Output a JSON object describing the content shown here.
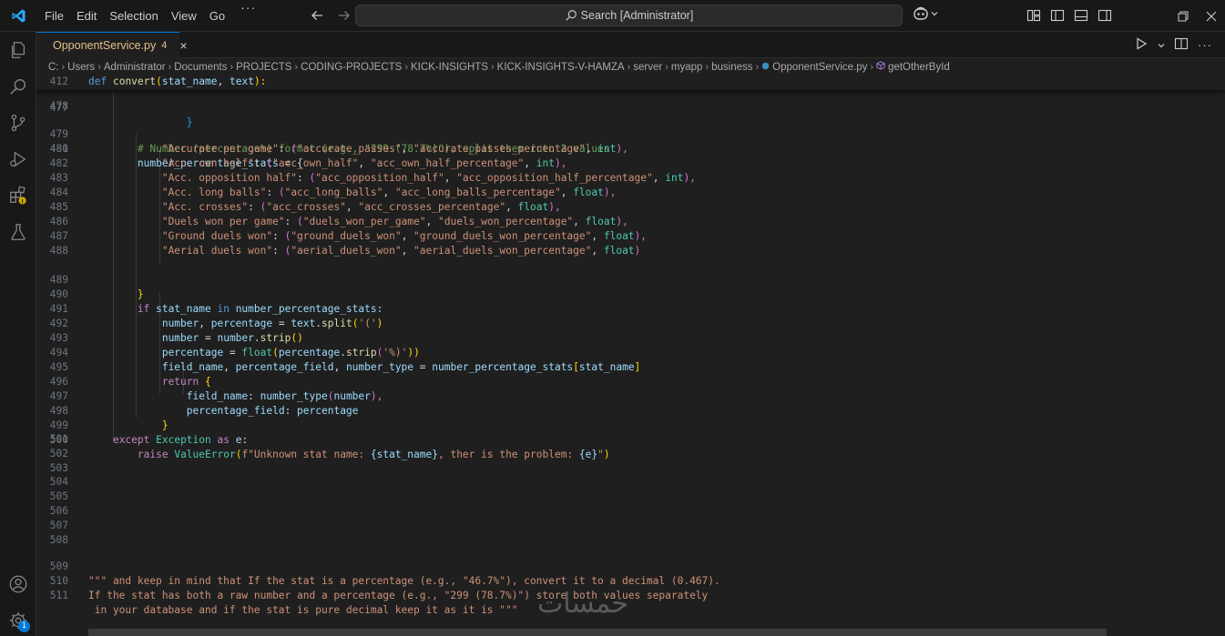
{
  "menu": [
    "File",
    "Edit",
    "Selection",
    "View",
    "Go",
    "···"
  ],
  "search": {
    "label": "Search [Administrator]"
  },
  "tab": {
    "filename": "OpponentService.py",
    "problems": "4",
    "close": "×"
  },
  "breadcrumb": [
    "C:",
    "Users",
    "Administrator",
    "Documents",
    "PROJECTS",
    "CODING-PROJECTS",
    "KICK-INSIGHTS",
    "KICK-INSIGHTS-V-HAMZA",
    "server",
    "myapp",
    "business",
    "OpponentService.py",
    "getOtherById"
  ],
  "activity": {
    "extensions_badge": "⚠",
    "accounts_badge": "",
    "settings_badge": "1"
  },
  "sticky": {
    "line_number": "412",
    "lines_hidden": "477"
  },
  "code": {
    "l412": [
      "def",
      " ",
      "convert",
      "(",
      "stat_name",
      ", ",
      "text",
      "):"
    ],
    "l477": "}",
    "l479": "# Number (percentage%) format (e.g., \"299 (78.7%)\"), split them into 2 values",
    "l480_var": "number_percentage_stats",
    "l480_rest": " = {",
    "stats": [
      {
        "ln": "481",
        "key": "\"Accurate per game\"",
        "a": "\"accurate_passes\"",
        "b": "\"accurate_passes_percentage\"",
        "t": "int",
        "end": "),"
      },
      {
        "ln": "482",
        "key": "\"Acc. own half\"",
        "a": "\"acc_own_half\"",
        "b": "\"acc_own_half_percentage\"",
        "t": "int",
        "end": "),"
      },
      {
        "ln": "483",
        "key": "\"Acc. opposition half\"",
        "a": "\"acc_opposition_half\"",
        "b": "\"acc_opposition_half_percentage\"",
        "t": "int",
        "end": "),"
      },
      {
        "ln": "484",
        "key": "\"Acc. long balls\"",
        "a": "\"acc_long_balls\"",
        "b": "\"acc_long_balls_percentage\"",
        "t": "float",
        "end": "),"
      },
      {
        "ln": "485",
        "key": "\"Acc. crosses\"",
        "a": "\"acc_crosses\"",
        "b": "\"acc_crosses_percentage\"",
        "t": "float",
        "end": "),"
      },
      {
        "ln": "486",
        "key": "\"Duels won per game\"",
        "a": "\"duels_won_per_game\"",
        "b": "\"duels_won_percentage\"",
        "t": "float",
        "end": "),"
      },
      {
        "ln": "487",
        "key": "\"Ground duels won\"",
        "a": "\"ground_duels_won\"",
        "b": "\"ground_duels_won_percentage\"",
        "t": "float",
        "end": "),"
      },
      {
        "ln": "488",
        "key": "\"Aerial duels won\"",
        "a": "\"aerial_duels_won\"",
        "b": "\"aerial_duels_won_percentage\"",
        "t": "float",
        "end": ")"
      }
    ],
    "l489": "}",
    "l490": [
      "if",
      " stat_name ",
      "in",
      " number_percentage_stats:"
    ],
    "l491": [
      "number",
      ", ",
      "percentage",
      " = ",
      "text",
      ".",
      "split",
      "(",
      "'('",
      ")"
    ],
    "l492": [
      "number",
      " = ",
      "number",
      ".",
      "strip",
      "()"
    ],
    "l493": [
      "percentage",
      " = ",
      "float",
      "(",
      "percentage",
      ".",
      "strip",
      "(",
      "'%)'",
      "))"
    ],
    "l494": [
      "field_name",
      ", ",
      "percentage_field",
      ", ",
      "number_type",
      " = ",
      "number_percentage_stats",
      "[",
      "stat_name",
      "]"
    ],
    "l495": [
      "return",
      " ",
      "{"
    ],
    "l496": [
      "field_name",
      ": ",
      "number_type",
      "(",
      "number",
      "),"
    ],
    "l497": [
      "percentage_field",
      ": ",
      "percentage"
    ],
    "l498": "}",
    "l499": [
      "except",
      " ",
      "Exception",
      " ",
      "as",
      " ",
      "e",
      ":"
    ],
    "l500": [
      "raise",
      " ",
      "ValueError",
      "(",
      "f\"Unknown stat name: ",
      "{stat_name}",
      ", ther is the problem: ",
      "{e}",
      "\"",
      ")"
    ],
    "blank_lines": [
      "501",
      "502",
      "503",
      "504",
      "505",
      "506",
      "507",
      "508"
    ],
    "l509": "\"\"\" and keep in mind that If the stat is a percentage (e.g., \"46.7%\"), convert it to a decimal (0.467).",
    "l510": "If the stat has both a raw number and a percentage (e.g., \"299 (78.7%)\") store both values separately",
    "l511": " in your database and if the stat is pure decimal keep it as it is \"\"\""
  },
  "line_numbers": {
    "l478": "478",
    "l479": "479",
    "l480": "480",
    "l489": "489",
    "l490": "490",
    "l491": "491",
    "l492": "492",
    "l493": "493",
    "l494": "494",
    "l495": "495",
    "l496": "496",
    "l497": "497",
    "l498": "498",
    "l499": "499",
    "l500": "500",
    "l509": "509",
    "l510": "510",
    "l511": "511"
  },
  "watermark": "خمسات",
  "colors": {
    "accent": "#0078d4",
    "modified": "#e2c08d",
    "background": "#1f1f1f"
  }
}
